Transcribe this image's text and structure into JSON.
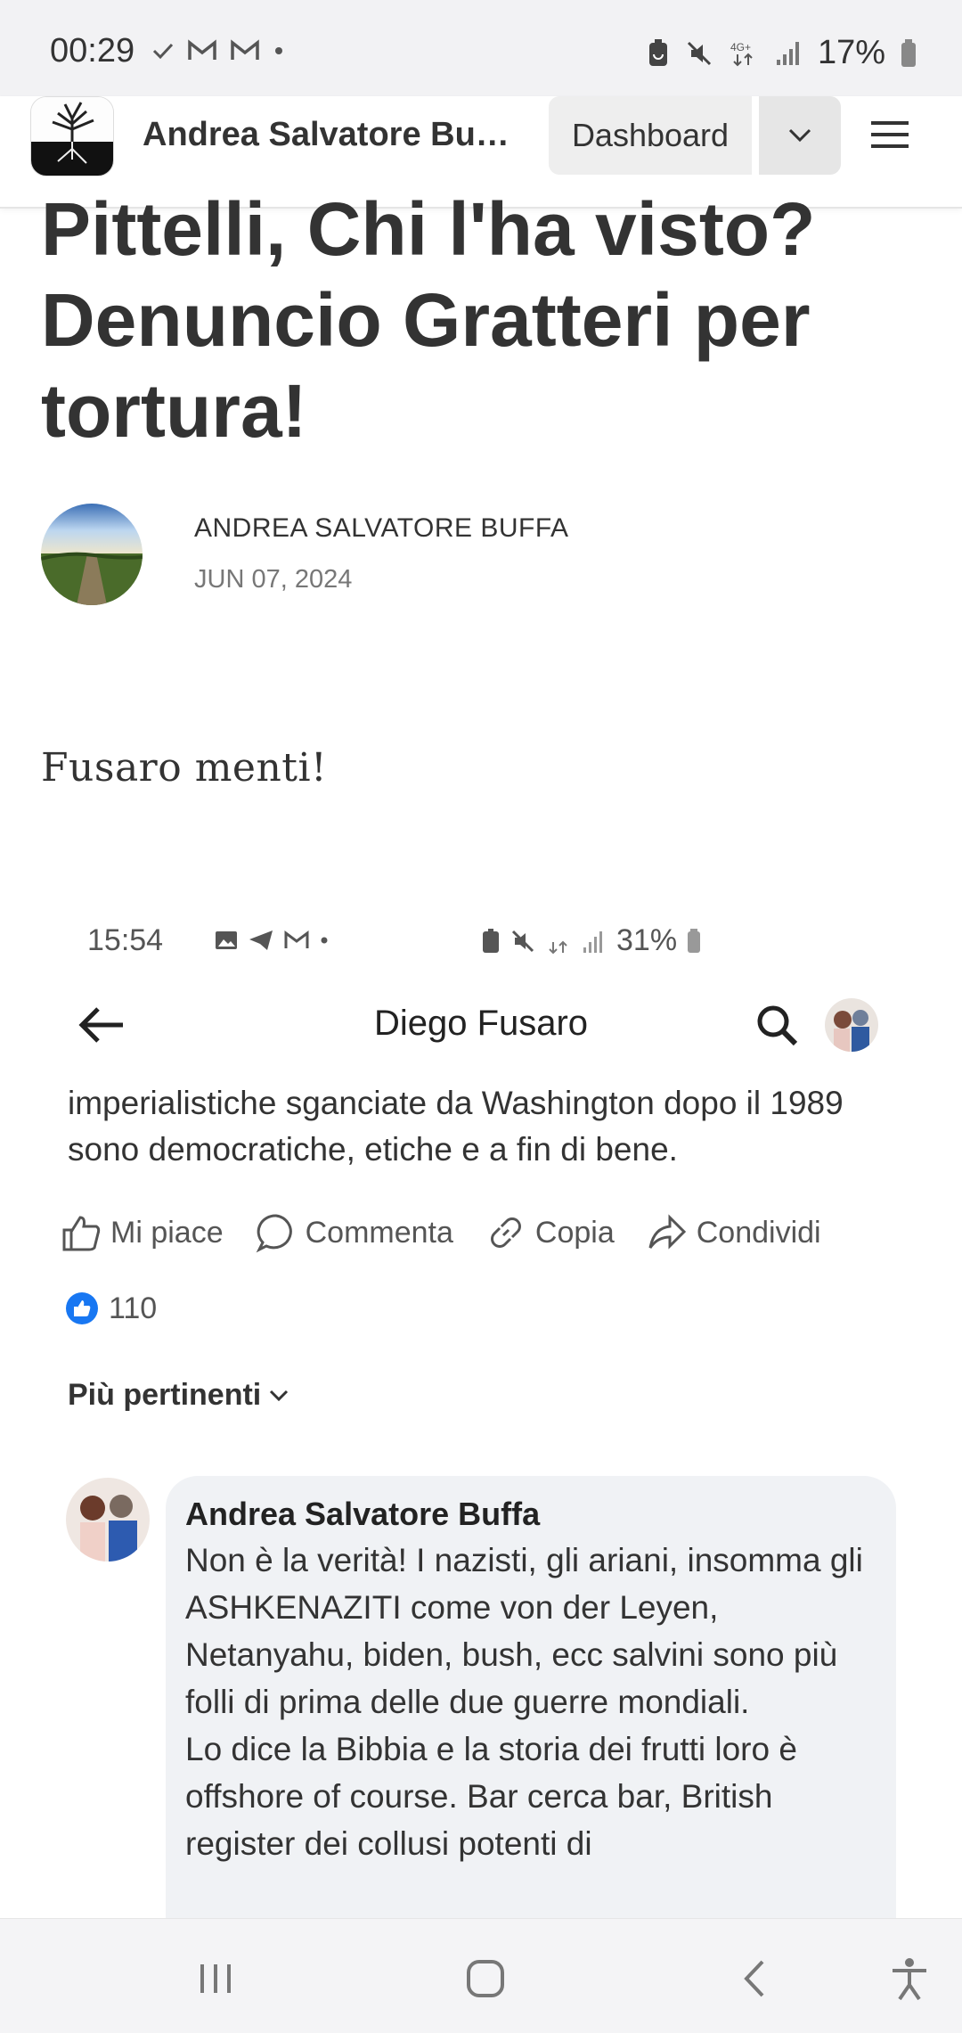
{
  "status_bar": {
    "time": "00:29",
    "battery": "17%",
    "icons": [
      "check-icon",
      "gmail-icon",
      "gmail-icon",
      "dot-icon",
      "battery-saver-icon",
      "mute-icon",
      "network-4g-icon",
      "signal-icon",
      "battery-icon"
    ]
  },
  "header": {
    "site_title": "Andrea Salvatore Buff...",
    "dashboard_label": "Dashboard"
  },
  "article": {
    "title": "Pittelli, Chi l'ha visto? Denuncio Gratteri per tortura!",
    "author": "ANDREA SALVATORE BUFFA",
    "date": "JUN 07, 2024",
    "lead": "Fusaro menti!"
  },
  "embedded_screenshot": {
    "time": "15:54",
    "battery": "31%",
    "page_title": "Diego Fusaro",
    "post_text": "imperialistiche sganciate da Washington dopo il 1989 sono democratiche, etiche e a fin di bene.",
    "actions": {
      "like": "Mi piace",
      "comment": "Commenta",
      "copy": "Copia",
      "share": "Condividi"
    },
    "like_count": "110",
    "sort_label": "Più pertinenti",
    "comment": {
      "author": "Andrea Salvatore Buffa",
      "text": "Non è la verità! I nazisti, gli ariani, insomma gli ASHKENAZITI come von der Leyen, Netanyahu, biden, bush, ecc salvini sono più folli di prima delle due guerre mondiali.\nLo dice la Bibbia e la storia dei frutti loro è offshore of course. Bar cerca bar, British register dei collusi potenti di"
    }
  },
  "colors": {
    "status_bg": "#f2f2f4",
    "text_dark": "#333333",
    "facebook_blue": "#1877f2",
    "bubble_bg": "#f0f2f5"
  }
}
